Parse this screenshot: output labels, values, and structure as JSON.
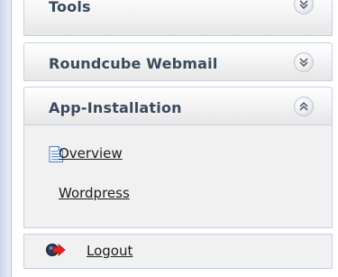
{
  "sections": {
    "tools": {
      "label": "Tools",
      "state": "collapsed",
      "toggle_icon": "double-chevron-down-icon"
    },
    "roundcube": {
      "label": "Roundcube Webmail",
      "state": "collapsed",
      "toggle_icon": "double-chevron-down-icon"
    },
    "app_installation": {
      "label": "App-Installation",
      "state": "expanded",
      "toggle_icon": "double-chevron-up-icon",
      "items": [
        {
          "label": "Overview",
          "icon": "document-icon"
        },
        {
          "label": "Wordpress",
          "icon": ""
        }
      ]
    }
  },
  "logout": {
    "label": "Logout",
    "icon": "logout-arrow-icon"
  },
  "colors": {
    "header_text": "#3a4a5c",
    "link_text": "#1c1c1c",
    "border": "#c8d0e0",
    "panel_bg": "#f1f1f1",
    "logout_arrow": "#e8211c"
  }
}
